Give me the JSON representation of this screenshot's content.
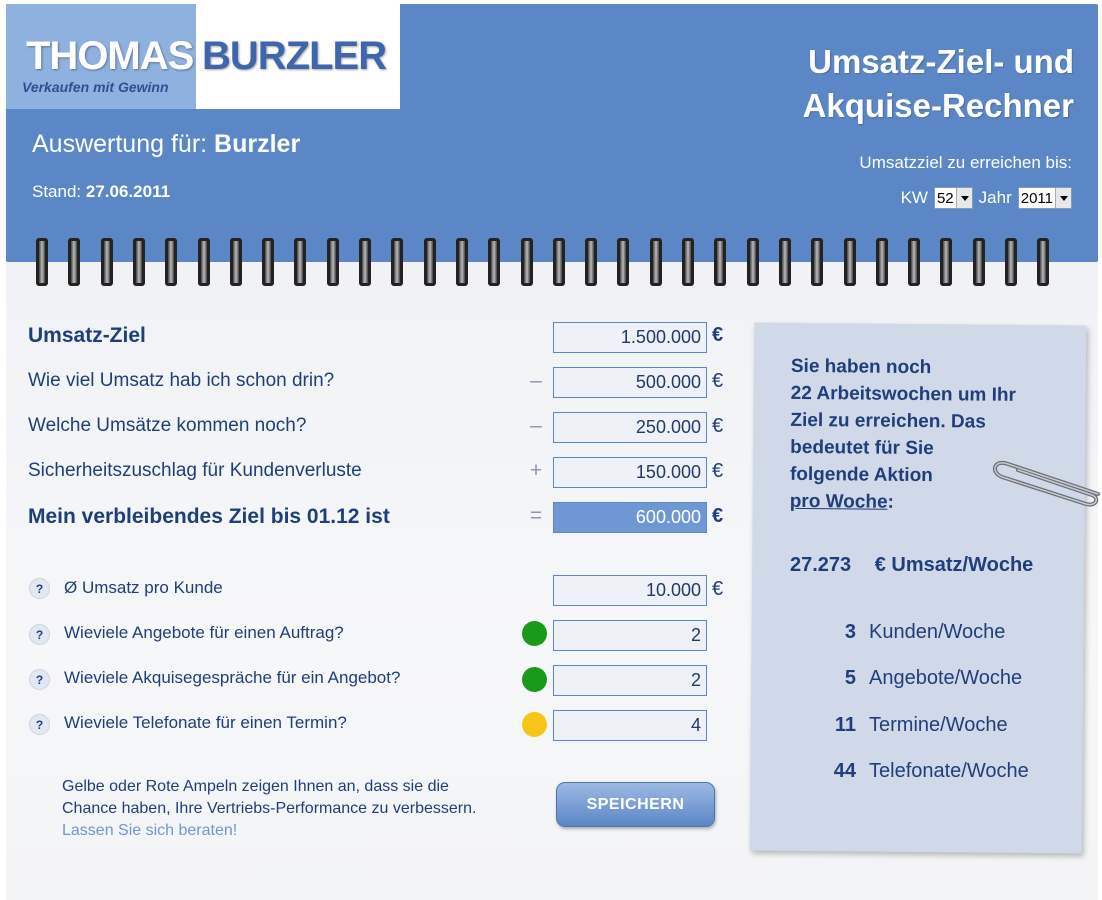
{
  "brand": {
    "name_first": "THOMAS",
    "name_last": "BURZLER",
    "tagline": "Verkaufen mit Gewinn"
  },
  "header": {
    "title_line1": "Umsatz-Ziel- und",
    "title_line2": "Akquise-Rechner",
    "auswertung_label": "Auswertung für:",
    "auswertung_name": "Burzler",
    "stand_label": "Stand:",
    "stand_date": "27.06.2011",
    "target_label": "Umsatzziel zu erreichen bis:",
    "kw_label": "KW",
    "kw_value": "52",
    "jahr_label": "Jahr",
    "jahr_value": "2011"
  },
  "calc": {
    "umsatz_ziel": {
      "label": "Umsatz-Ziel",
      "value": "1.500.000",
      "unit": "€"
    },
    "schon_drin": {
      "label": "Wie viel Umsatz hab ich schon drin?",
      "op": "–",
      "value": "500.000",
      "unit": "€"
    },
    "kommen_noch": {
      "label": "Welche Umsätze kommen noch?",
      "op": "–",
      "value": "250.000",
      "unit": "€"
    },
    "sicherheit": {
      "label": "Sicherheitszuschlag für Kundenverluste",
      "op": "+",
      "value": "150.000",
      "unit": "€"
    },
    "verbleibend": {
      "label": "Mein verbleibendes Ziel bis 01.12 ist",
      "op": "=",
      "value": "600.000",
      "unit": "€"
    }
  },
  "questions": {
    "help_glyph": "?",
    "umsatz_kunde": {
      "label": "Ø Umsatz pro Kunde",
      "value": "10.000",
      "unit": "€"
    },
    "angebote": {
      "label": "Wieviele Angebote für einen Auftrag?",
      "value": "2",
      "light": "#1a9a1a"
    },
    "akquise": {
      "label": "Wieviele Akquisegespräche für ein Angebot?",
      "value": "2",
      "light": "#1a9a1a"
    },
    "telefonate": {
      "label": "Wieviele Telefonate für einen Termin?",
      "value": "4",
      "light": "#f5c518"
    }
  },
  "note": {
    "text": "Gelbe oder Rote Ampeln zeigen Ihnen an, dass sie die Chance haben, Ihre Vertriebs-Performance zu verbessern.",
    "link": "Lassen Sie sich beraten!"
  },
  "save_label": "SPEICHERN",
  "result": {
    "intro_line1": "Sie haben noch",
    "intro_line2": "22 Arbeitswochen um Ihr",
    "intro_line3": "Ziel zu erreichen. Das",
    "intro_line4": "bedeutet für Sie",
    "intro_line5": "folgende Aktion",
    "intro_line6_link": "pro Woche",
    "intro_line6_tail": ":",
    "umsatz_value": "27.273",
    "umsatz_label": "€ Umsatz/Woche",
    "stats": [
      {
        "value": "3",
        "label": "Kunden/Woche"
      },
      {
        "value": "5",
        "label": "Angebote/Woche"
      },
      {
        "value": "11",
        "label": "Termine/Woche"
      },
      {
        "value": "44",
        "label": "Telefonate/Woche"
      }
    ]
  },
  "colors": {
    "header_blue": "#5b87c6",
    "text_navy": "#1f3f7a",
    "ampel_green": "#1a9a1a",
    "ampel_yellow": "#f5c518"
  }
}
